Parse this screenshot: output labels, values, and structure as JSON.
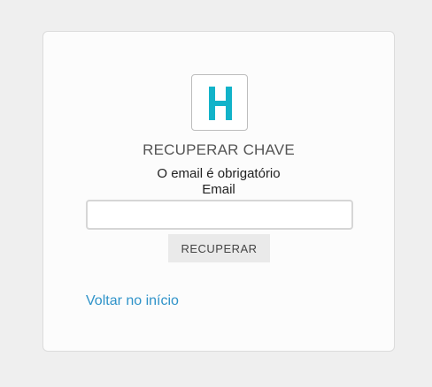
{
  "logo": {
    "icon": "h-logo-icon",
    "letter": "H",
    "color": "#12b3c9"
  },
  "form": {
    "title": "RECUPERAR CHAVE",
    "error_message": "O email é obrigatório",
    "email_label": "Email",
    "email_value": "",
    "email_placeholder": "",
    "submit_label": "RECUPERAR"
  },
  "links": {
    "back_label": "Voltar no início"
  },
  "colors": {
    "link": "#2f93c9",
    "background": "#efefef",
    "card": "#fcfcfc"
  }
}
